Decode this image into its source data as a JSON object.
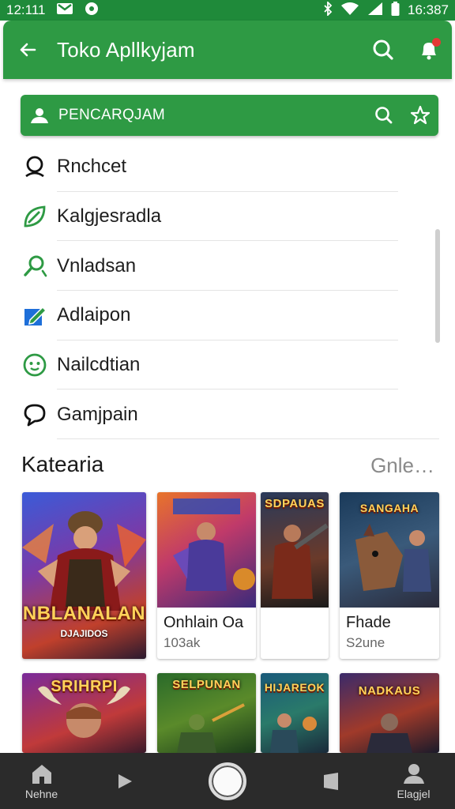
{
  "status_bar": {
    "time_left": "12:111",
    "time_right": "16:387"
  },
  "app_bar": {
    "title": "Toko Apllkyjam"
  },
  "search": {
    "label": "PENCARQJAM"
  },
  "menu": {
    "items": [
      {
        "label": "Rnchcet",
        "icon": "person-outline-icon",
        "color": "#111111"
      },
      {
        "label": "Kalgjesradla",
        "icon": "leaf-icon",
        "color": "#2e9a44"
      },
      {
        "label": "Vnladsan",
        "icon": "key-search-icon",
        "color": "#2e9a44"
      },
      {
        "label": "Adlaipon",
        "icon": "edit-box-icon",
        "color": "#1e6fd9"
      },
      {
        "label": "Nailcdtian",
        "icon": "smiley-icon",
        "color": "#2e9a44"
      },
      {
        "label": "Gamjpain",
        "icon": "chat-bubble-icon",
        "color": "#111111"
      }
    ]
  },
  "category": {
    "title": "Katearia",
    "more": "Gnle…"
  },
  "cards_row1": [
    {
      "art_title": "NBLANALAN",
      "art_sub": "DJAJIDOS",
      "caption_title": "",
      "caption_sub": ""
    },
    {
      "art_title": "",
      "art_sub": "",
      "caption_title": "Onhlain Oa",
      "caption_sub": "103ak"
    },
    {
      "art_title": "SDPAUAS",
      "art_sub": "",
      "caption_title": "",
      "caption_sub": ""
    },
    {
      "art_title": "SANGAHA",
      "art_sub": "",
      "caption_title": "Fhade",
      "caption_sub": "S2une"
    }
  ],
  "cards_row2": [
    {
      "art_title": "SRIHRPI"
    },
    {
      "art_title": "SELPUNAN"
    },
    {
      "art_title": "HIJAREOK"
    },
    {
      "art_title": "NADKAUS"
    }
  ],
  "bottom_nav": {
    "home_label": "Nehne",
    "profile_label": "Elagjel"
  },
  "colors": {
    "primary": "#2e9a44",
    "status": "#1f8a3a",
    "nav_bg": "#2b2b2b"
  }
}
